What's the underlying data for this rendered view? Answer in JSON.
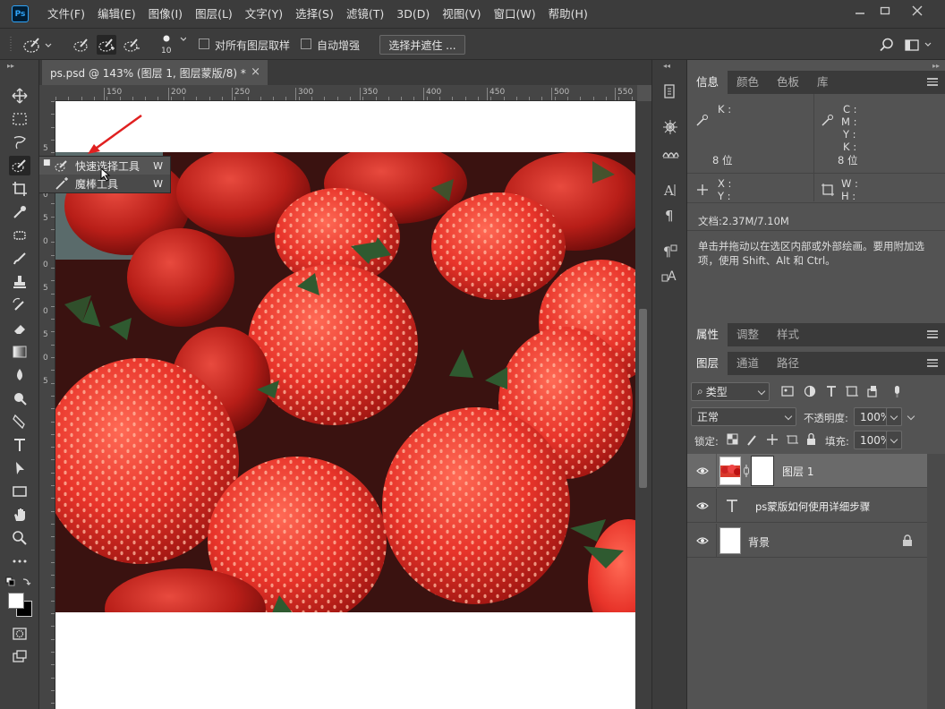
{
  "app": {
    "logo_text": "Ps"
  },
  "menu": [
    "文件(F)",
    "编辑(E)",
    "图像(I)",
    "图层(L)",
    "文字(Y)",
    "选择(S)",
    "滤镜(T)",
    "3D(D)",
    "视图(V)",
    "窗口(W)",
    "帮助(H)"
  ],
  "options": {
    "brush_size": "10",
    "sample_all_label": "对所有图层取样",
    "auto_enhance_label": "自动增强",
    "select_mask_button": "选择并遮住 ..."
  },
  "document": {
    "tab_title": "ps.psd @ 143% (图层 1, 图层蒙版/8) *",
    "close_glyph": "×"
  },
  "ruler": {
    "top_ticks": [
      "150",
      "200",
      "250",
      "300",
      "350",
      "400",
      "450",
      "500",
      "550"
    ],
    "left_ticks": [
      "5",
      "0",
      "0",
      "5",
      "0",
      "0",
      "5",
      "0",
      "5",
      "0",
      "5"
    ]
  },
  "tool_flyout": {
    "items": [
      {
        "label": "快速选择工具",
        "shortcut": "W"
      },
      {
        "label": "魔棒工具",
        "shortcut": "W"
      }
    ]
  },
  "info_panel": {
    "tabs": [
      "信息",
      "颜色",
      "色板",
      "库"
    ],
    "k_label": "K :",
    "c_label": "C :",
    "m_label": "M :",
    "y_label": "Y :",
    "k2_label": "K :",
    "bits_left": "8 位",
    "bits_right": "8 位",
    "x_label": "X :",
    "y_coord_label": "Y :",
    "w_label": "W :",
    "h_label": "H :",
    "doc_size": "文档:2.37M/7.10M",
    "hint": "单击并拖动以在选区内部或外部绘画。要用附加选项，使用 Shift、Alt 和 Ctrl。"
  },
  "props_tabs": [
    "属性",
    "调整",
    "样式"
  ],
  "layers_panel": {
    "tabs": [
      "图层",
      "通道",
      "路径"
    ],
    "filter_label": "类型",
    "blend_mode": "正常",
    "opacity_label": "不透明度:",
    "opacity_value": "100%",
    "lock_label": "锁定:",
    "fill_label": "填充:",
    "fill_value": "100%",
    "layers": [
      {
        "name": "图层 1",
        "type": "image-mask",
        "selected": true
      },
      {
        "name": "ps蒙版如何使用详细步骤",
        "type": "text",
        "selected": false
      },
      {
        "name": "背景",
        "type": "background",
        "selected": false,
        "locked": true
      }
    ]
  },
  "colors": {
    "accent_blue": "#2fa3f7",
    "annotation_red": "#e02020",
    "selected_row": "#6a6a6a"
  }
}
